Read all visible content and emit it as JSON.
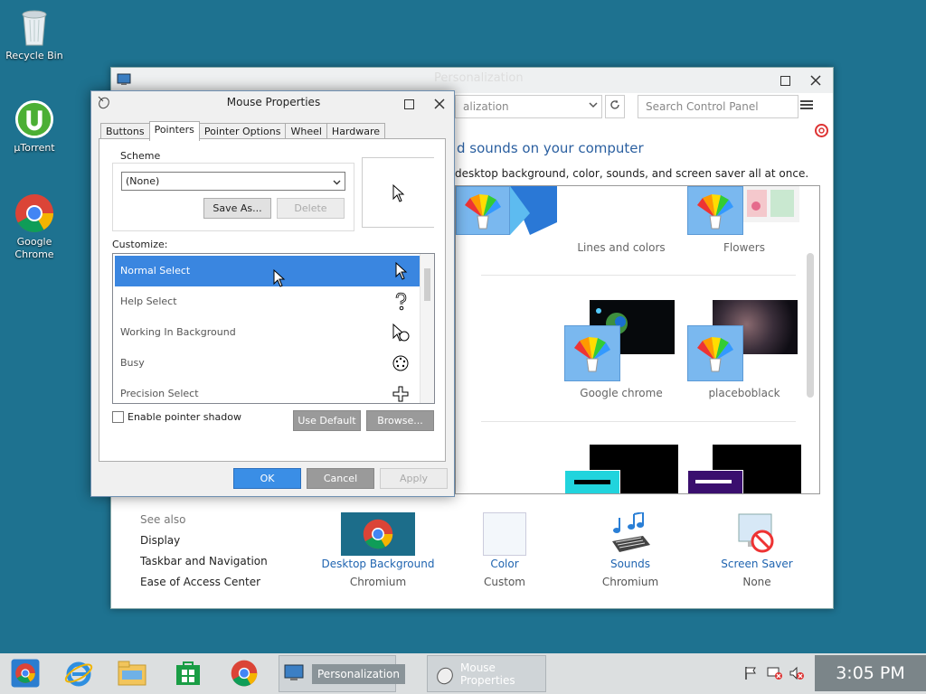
{
  "desktop": {
    "icons": [
      {
        "label": "Recycle Bin"
      },
      {
        "label": "µTorrent"
      },
      {
        "label": "Google Chrome"
      }
    ]
  },
  "personalization": {
    "title": "Personalization",
    "address": "alization",
    "search_placeholder": "Search Control Panel",
    "heading": "d sounds on your computer",
    "subheading": "desktop background, color, sounds, and screen saver all at once.",
    "themes": [
      {
        "label": "Lines and colors"
      },
      {
        "label": "Flowers"
      },
      {
        "label": "Google chrome"
      },
      {
        "label": "placeboblack"
      }
    ],
    "see_also": {
      "title": "See also",
      "links": [
        "Display",
        "Taskbar and Navigation",
        "Ease of Access Center"
      ]
    },
    "bottom": [
      {
        "label": "Desktop Background",
        "value": "Chromium"
      },
      {
        "label": "Color",
        "value": "Custom"
      },
      {
        "label": "Sounds",
        "value": "Chromium"
      },
      {
        "label": "Screen Saver",
        "value": "None"
      }
    ]
  },
  "mouse_properties": {
    "title": "Mouse Properties",
    "tabs": [
      "Buttons",
      "Pointers",
      "Pointer Options",
      "Wheel",
      "Hardware"
    ],
    "active_tab": "Pointers",
    "scheme_label": "Scheme",
    "scheme_value": "(None)",
    "save_as": "Save As...",
    "delete": "Delete",
    "customize_label": "Customize:",
    "cursors": [
      {
        "name": "Normal Select",
        "icon": "arrow-cursor-icon"
      },
      {
        "name": "Help Select",
        "icon": "help-cursor-icon"
      },
      {
        "name": "Working In Background",
        "icon": "working-cursor-icon"
      },
      {
        "name": "Busy",
        "icon": "busy-cursor-icon"
      },
      {
        "name": "Precision Select",
        "icon": "precision-cursor-icon"
      }
    ],
    "selected_index": 0,
    "shadow_label": "Enable pointer shadow",
    "use_default": "Use Default",
    "browse": "Browse...",
    "ok": "OK",
    "cancel": "Cancel",
    "apply": "Apply"
  },
  "taskbar": {
    "tasks": [
      {
        "label": "Personalization"
      },
      {
        "label": "Mouse Properties"
      }
    ],
    "clock": "3:05 PM"
  },
  "colors": {
    "desktop": "#1e7290",
    "accent": "#3a86e0",
    "link": "#1f64b0"
  }
}
